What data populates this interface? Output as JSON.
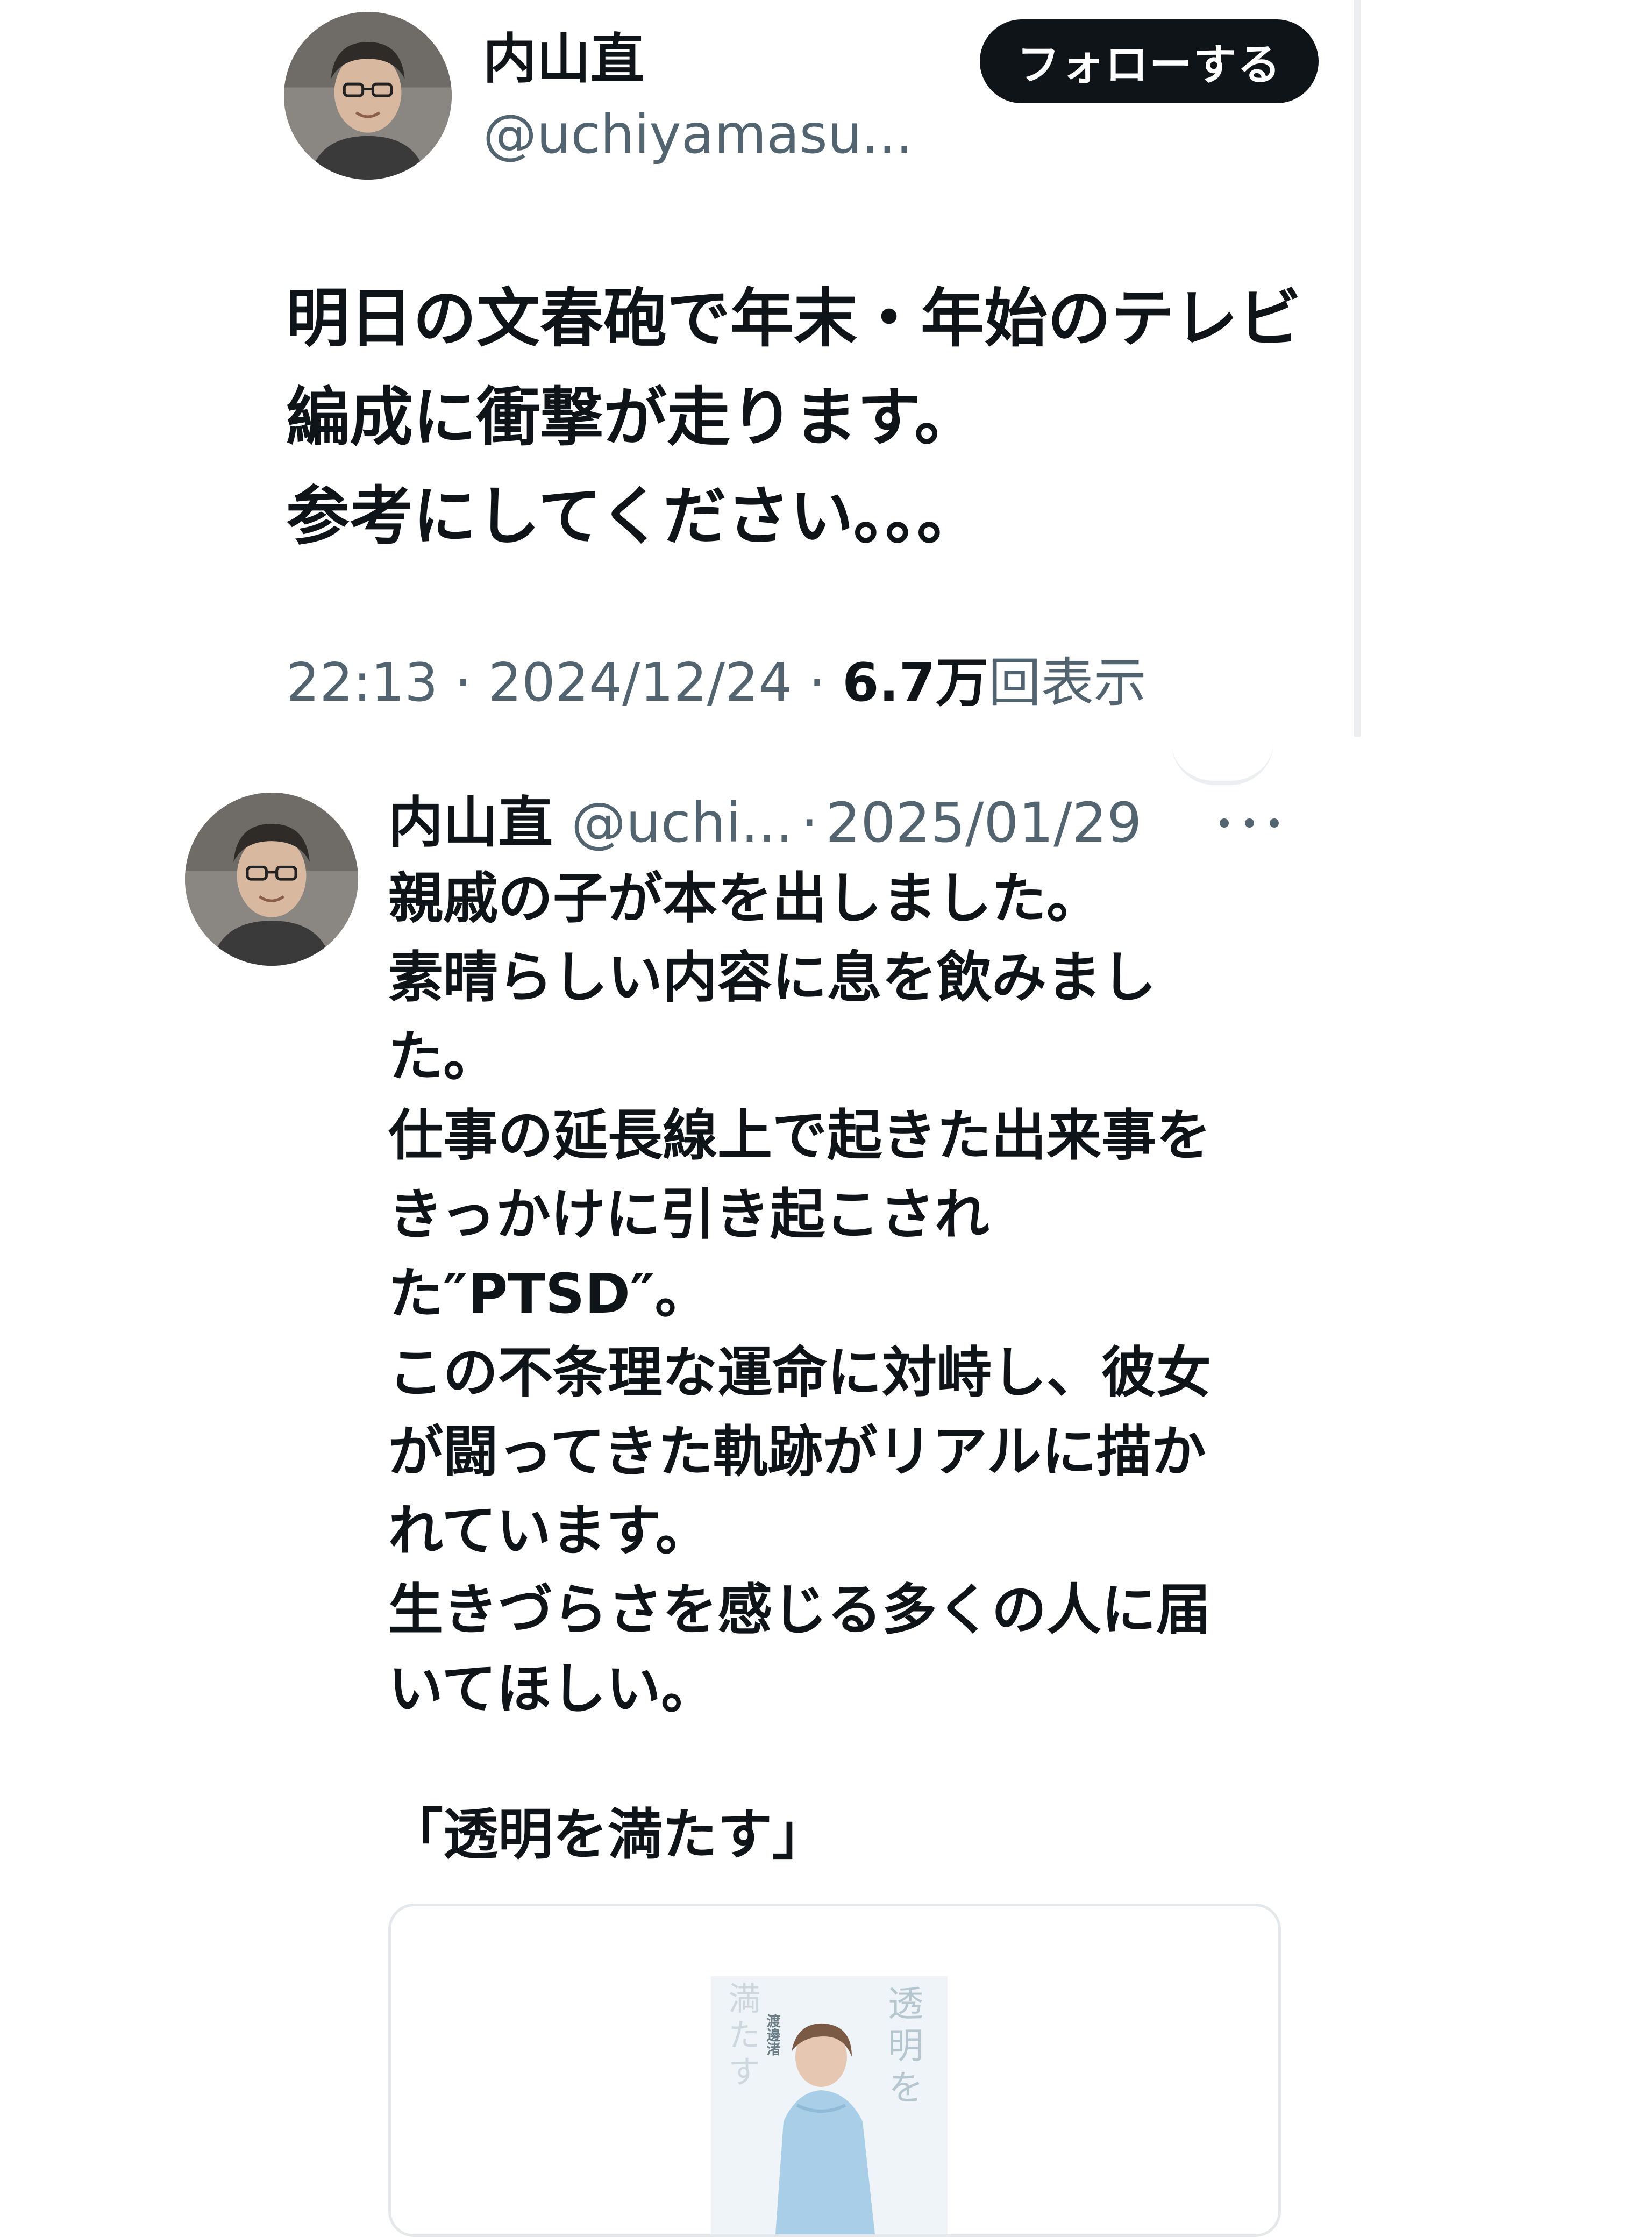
{
  "tweet1": {
    "author_name": "内山直",
    "author_handle": "@uchiyamasu...",
    "follow_label": "フォローする",
    "body": "明日の文春砲で年末・年始のテレビ\n編成に衝撃が走ります。\n参考にしてください。。。",
    "time": "22:13",
    "date": "2024/12/24",
    "views_count": "6.7万",
    "views_label": "回表示"
  },
  "tweet2": {
    "author_name": "内山直",
    "author_handle": "@uchi...",
    "date": "2025/01/29",
    "body": "親戚の子が本を出しました。\n素晴らしい内容に息を飲みまし\nた。\n仕事の延長線上で起きた出来事を\nきっかけに引き起こされ\nた″PTSD″。\nこの不条理な運命に対峙し、彼女\nが闘ってきた軌跡がリアルに描か\nれています。\n生きづらさを感じる多くの人に届\nいてほしい。",
    "quoted_title": "「透明を満たす」",
    "book_cover": {
      "title": "透明を",
      "title_side": "満たす",
      "author": "渡邊渚"
    }
  },
  "icons": {
    "more": "more-horizontal-icon",
    "avatar": "profile-photo"
  },
  "colors": {
    "text_primary": "#0f1419",
    "text_secondary": "#536471",
    "follow_button_bg": "#0f1419",
    "border": "#e5e8eb"
  }
}
